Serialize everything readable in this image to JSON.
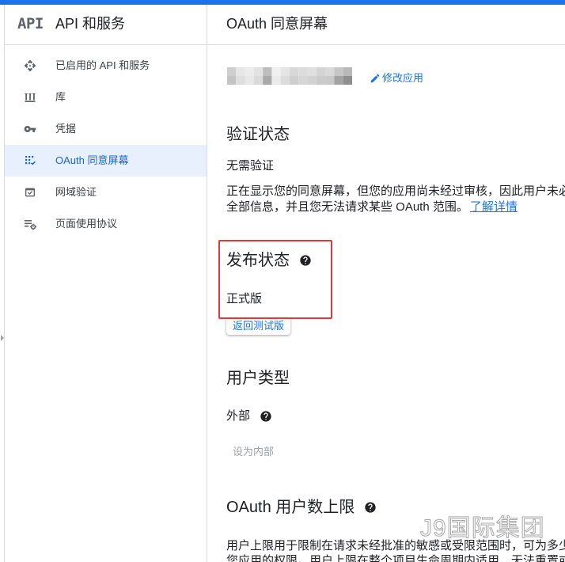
{
  "app": {
    "logo_text": "API",
    "title": "API 和服务"
  },
  "sidebar": {
    "items": [
      {
        "label": "已启用的 API 和服务",
        "icon": "api-icon",
        "selected": false
      },
      {
        "label": "库",
        "icon": "library-icon",
        "selected": false
      },
      {
        "label": "凭据",
        "icon": "key-icon",
        "selected": false
      },
      {
        "label": "OAuth 同意屏幕",
        "icon": "oauth-consent-icon",
        "selected": true
      },
      {
        "label": "网域验证",
        "icon": "domain-verification-icon",
        "selected": false
      },
      {
        "label": "页面使用协议",
        "icon": "page-usage-agreements-icon",
        "selected": false
      }
    ],
    "collapse_handle_icon": "triangle-right-icon"
  },
  "page": {
    "title": "OAuth 同意屏幕",
    "edit_app": {
      "label": "修改应用",
      "icon": "pencil-icon"
    },
    "verification_status": {
      "heading": "验证状态",
      "value": "无需验证",
      "description_lines": [
        "正在显示您的同意屏幕，但您的应用尚未经过审核，因此用户未必",
        "全部信息，并且您无法请求某些 OAuth 范围。"
      ],
      "learn_more_label": "了解详情"
    },
    "publishing_status": {
      "heading": "发布状态",
      "help_icon": "help-circle-icon",
      "value": "正式版",
      "back_to_testing_label": "返回测试版"
    },
    "user_type": {
      "heading": "用户类型",
      "value": "外部",
      "help_icon": "help-circle-icon",
      "make_internal_label": "设为内部"
    },
    "user_cap": {
      "heading": "OAuth 用户数上限",
      "help_icon": "help-circle-icon",
      "description_lines": [
        "用户上限用于限制在请求未经批准的敏感或受限范围时，可为多少",
        "您应用的权限。用户上限在整个项目生命周期内适用，无法重置或"
      ]
    }
  },
  "watermark": {
    "text": "J9国际集团"
  },
  "colors": {
    "accent": "#1a73e8",
    "selected_bg": "#e8f0fe",
    "selected_text": "#1967d2",
    "annotation_red": "#e53935",
    "text_primary": "#202124",
    "text_secondary": "#3c4043",
    "icon_gray": "#5f6368",
    "divider": "#dadce0",
    "disabled": "#9aa0a6"
  }
}
